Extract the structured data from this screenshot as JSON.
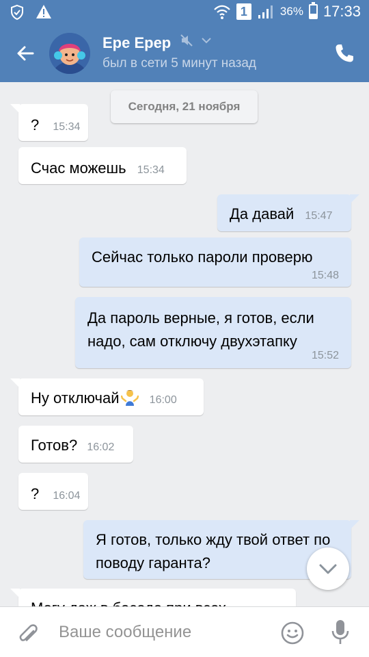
{
  "status_bar": {
    "battery": "36%",
    "battery_level": 0.36,
    "time": "17:33",
    "sim": "1"
  },
  "header": {
    "name": "Ере Ерер",
    "status": "был в сети 5 минут назад"
  },
  "date_separator": "Сегодня, 21 ноября",
  "messages": [
    {
      "dir": "in",
      "text": "?",
      "time": "15:34"
    },
    {
      "dir": "in",
      "text": "Счас можешь",
      "time": "15:34"
    },
    {
      "dir": "out",
      "text": "Да давай",
      "time": "15:47"
    },
    {
      "dir": "out",
      "text": "Сейчас только пароли проверю",
      "time": "15:48"
    },
    {
      "dir": "out",
      "text": "Да пароль верные, я готов, если надо, сам отключу двухэтапку",
      "time": "15:52"
    },
    {
      "dir": "in",
      "text": "Ну отключай",
      "time": "16:00",
      "emoji": "person-shrugging"
    },
    {
      "dir": "in",
      "text": "Готов?",
      "time": "16:02"
    },
    {
      "dir": "in",
      "text": "?",
      "time": "16:04"
    },
    {
      "dir": "out",
      "text": "Я готов, только жду твой ответ по поводу гаранта?",
      "time": ""
    },
    {
      "dir": "in",
      "text": "Могу даж в беседе при всех",
      "time": ""
    }
  ],
  "input": {
    "placeholder": "Ваше сообщение"
  },
  "colors": {
    "header": "#5181b8",
    "incoming": "#ffffff",
    "outgoing": "#dbe7f8",
    "background": "#edeef0"
  },
  "icons": [
    "shield-icon",
    "warning-icon",
    "wifi-icon",
    "signal-icon",
    "battery-icon",
    "back-arrow-icon",
    "mute-icon",
    "chevron-down-icon",
    "phone-icon",
    "chevron-down-icon",
    "paperclip-icon",
    "smile-icon",
    "microphone-icon"
  ]
}
